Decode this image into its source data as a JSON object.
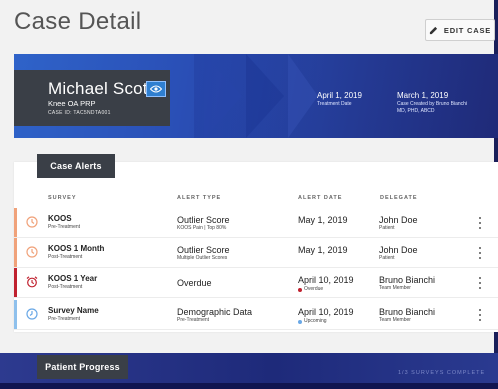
{
  "page": {
    "title": "Case Detail",
    "edit_label": "EDIT CASE"
  },
  "patient": {
    "name": "Michael Scott",
    "procedure": "Knee OA PRP",
    "case_id": "CASE ID: TAC5NDTA001",
    "treatment_date": "April 1, 2019",
    "treatment_date_label": "Treatment Date",
    "created_date": "March 1, 2019",
    "created_by_line1": "Case Created by Bruno Bianchi",
    "created_by_line2": "MD, PHD, ABCD"
  },
  "alerts": {
    "section_title": "Case Alerts",
    "columns": [
      "SURVEY",
      "ALERT TYPE",
      "ALERT DATE",
      "DELEGATE"
    ],
    "rows": [
      {
        "survey": "KOOS",
        "survey_sub": "Pre-Treatment",
        "alert_type": "Outlier Score",
        "alert_sub": "KOOS Pain | Top 80%",
        "date": "May 1, 2019",
        "date_sub": "",
        "delegate": "John Doe",
        "delegate_sub": "Patient",
        "accent": "#f0a27a",
        "icon": "clock-outline-icon"
      },
      {
        "survey": "KOOS 1 Month",
        "survey_sub": "Post-Treatment",
        "alert_type": "Outlier Score",
        "alert_sub": "Multiple Outlier Scores",
        "date": "May 1, 2019",
        "date_sub": "",
        "delegate": "John Doe",
        "delegate_sub": "Patient",
        "accent": "#f0a27a",
        "icon": "clock-outline-icon"
      },
      {
        "survey": "KOOS 1 Year",
        "survey_sub": "Post-Treatment",
        "alert_type": "Overdue",
        "alert_sub": "",
        "date": "April 10, 2019",
        "date_sub": "Overdue",
        "delegate": "Bruno Bianchi",
        "delegate_sub": "Team Member",
        "accent": "#c0212f",
        "icon": "alarm-clock-icon"
      },
      {
        "survey": "Survey Name",
        "survey_sub": "Pre-Treatment",
        "alert_type": "Demographic Data",
        "alert_sub": "Pre-Treatment",
        "date": "April 10, 2019",
        "date_sub": "Upcoming",
        "delegate": "Bruno Bianchi",
        "delegate_sub": "Team Member",
        "accent": "#8ec0ec",
        "icon": "clock-blue-icon"
      }
    ]
  },
  "progress": {
    "section_title": "Patient Progress",
    "status": "1/3 SURVEYS COMPLETE"
  },
  "colors": {
    "overdue": "#c0212f",
    "upcoming": "#6aa8e6",
    "outlier_accent": "#f0a27a",
    "hero_start": "#2f63c9",
    "hero_end": "#1f2a78"
  }
}
